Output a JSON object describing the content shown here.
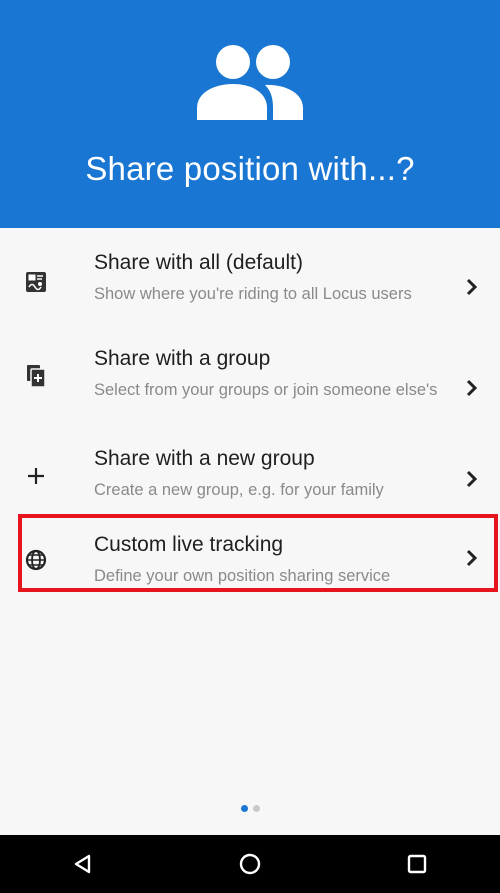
{
  "header": {
    "title": "Share position with...?",
    "icon": "group-icon",
    "background": "#1976d2"
  },
  "options": [
    {
      "title": "Share with all (default)",
      "subtitle": "Show where you're riding to all Locus users",
      "icon": "map-share-icon"
    },
    {
      "title": "Share with a group",
      "subtitle": "Select from your groups or join someone else's",
      "icon": "group-add-icon"
    },
    {
      "title": "Share with a new group",
      "subtitle": "Create a new group, e.g. for your family",
      "icon": "plus-icon"
    },
    {
      "title": "Custom live tracking",
      "subtitle": "Define your own position sharing service",
      "icon": "globe-icon"
    }
  ],
  "highlight_color": "#e5141d",
  "pager": {
    "current": 1,
    "total": 2
  },
  "navbar": {
    "buttons": [
      "back-icon",
      "home-icon",
      "recents-icon"
    ]
  }
}
